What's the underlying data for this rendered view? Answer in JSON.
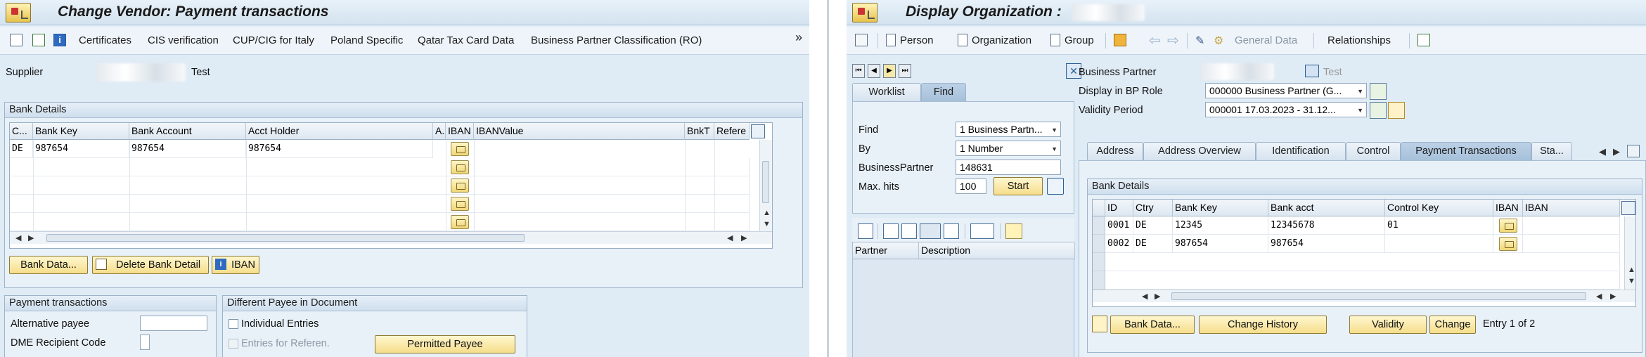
{
  "left": {
    "title": "Change Vendor: Payment transactions",
    "toolbar": {
      "more": "»",
      "items": [
        "Certificates",
        "CIS verification",
        "CUP/CIG for Italy",
        "Poland Specific",
        "Qatar Tax Card Data",
        "Business Partner Classification (RO)"
      ]
    },
    "supplier": {
      "label": "Supplier",
      "value": "Test"
    },
    "bank_details": {
      "title": "Bank Details",
      "columns": [
        "C...",
        "Bank Key",
        "Bank Account",
        "Acct Holder",
        "A..",
        "IBAN",
        "IBANValue",
        "BnkT",
        "Refere"
      ],
      "rows": [
        {
          "country": "DE",
          "bank_key": "987654",
          "bank_account": "987654",
          "acct_holder": "987654"
        }
      ],
      "buttons": {
        "bank_data": "Bank Data...",
        "delete": "Delete Bank Detail",
        "iban": "IBAN"
      }
    },
    "payment_transactions": {
      "title": "Payment transactions",
      "alt_payee": "Alternative payee",
      "dme": "DME Recipient Code"
    },
    "different_payee": {
      "title": "Different Payee in Document",
      "individual": "Individual Entries",
      "entries_ref": "Entries for Referen.",
      "permitted": "Permitted Payee"
    }
  },
  "right": {
    "title_prefix": "Display Organization :",
    "toolbar": {
      "person": "Person",
      "organization": "Organization",
      "group": "Group",
      "general_data": "General Data",
      "relationships": "Relationships"
    },
    "header": {
      "bp_label": "Business Partner",
      "bp_value": "Test",
      "role_label": "Display in BP Role",
      "role_value": "000000 Business Partner (G...",
      "validity_label": "Validity Period",
      "validity_value": "000001 17.03.2023 - 31.12..."
    },
    "locator": {
      "tabs": [
        "Worklist",
        "Find"
      ],
      "find_label": "Find",
      "find_value": "1 Business Partn...",
      "by_label": "By",
      "by_value": "1 Number",
      "bp_label": "BusinessPartner",
      "bp_value": "148631",
      "maxhits_label": "Max. hits",
      "maxhits_value": "100",
      "start": "Start",
      "columns": [
        "Partner",
        "Description"
      ]
    },
    "tabs": [
      "Address",
      "Address Overview",
      "Identification",
      "Control",
      "Payment Transactions",
      "Sta..."
    ],
    "bank_details": {
      "title": "Bank Details",
      "columns": [
        "ID",
        "Ctry",
        "Bank Key",
        "Bank acct",
        "Control Key",
        "IBAN",
        "IBAN"
      ],
      "rows": [
        {
          "id": "0001",
          "ctry": "DE",
          "bank_key": "12345",
          "bank_acct": "12345678",
          "control_key": "01"
        },
        {
          "id": "0002",
          "ctry": "DE",
          "bank_key": "987654",
          "bank_acct": "987654",
          "control_key": ""
        }
      ],
      "buttons": {
        "bank_data": "Bank Data...",
        "history": "Change History",
        "validity": "Validity",
        "change": "Change"
      },
      "entry_info": "Entry 1 of 2"
    }
  }
}
